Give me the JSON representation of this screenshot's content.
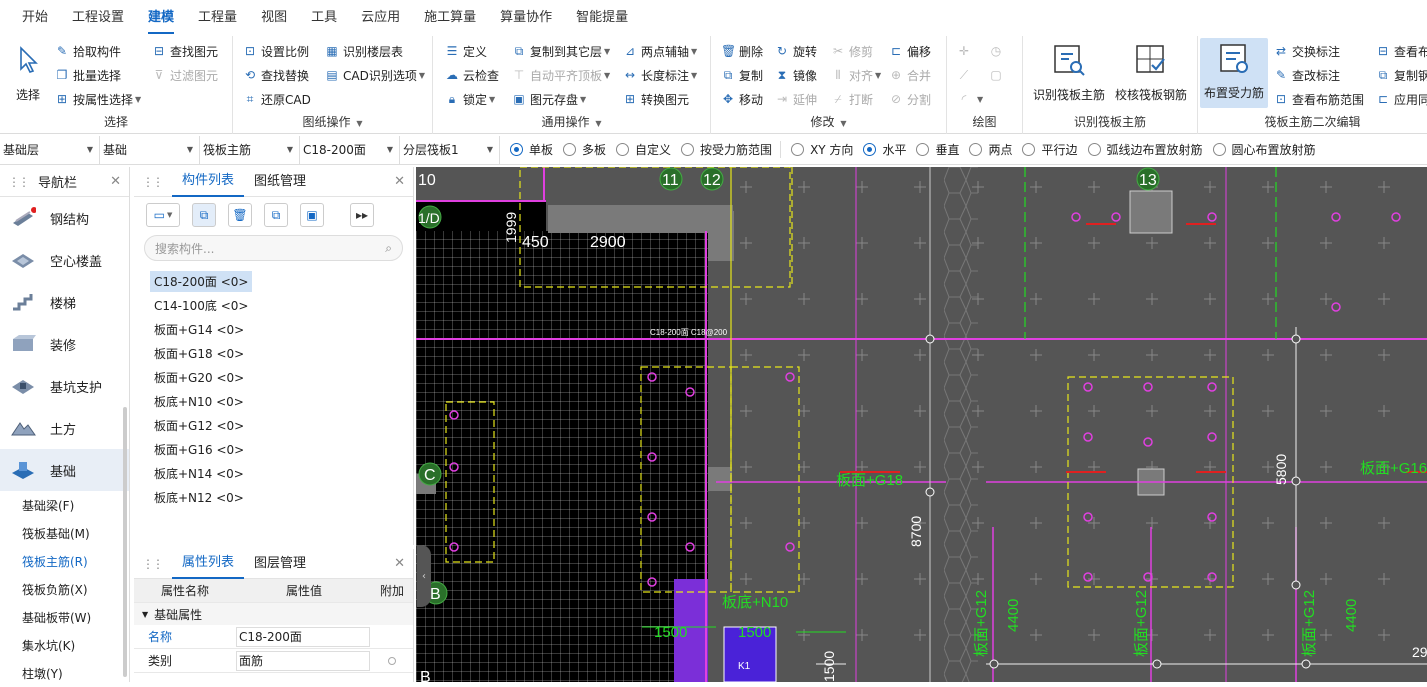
{
  "menu": [
    "开始",
    "工程设置",
    "建模",
    "工程量",
    "视图",
    "工具",
    "云应用",
    "施工算量",
    "算量协作",
    "智能提量"
  ],
  "active_menu": "建模",
  "ribbon": {
    "select_group": {
      "label": "选择",
      "big": "选择",
      "buttons": [
        "拾取构件",
        "批量选择",
        "按属性选择"
      ]
    },
    "drawing_group": {
      "label": "图纸操作",
      "buttons": [
        "查找图元",
        "过滤图元",
        "设置比例",
        "查找替换",
        "还原CAD",
        "识别楼层表",
        "CAD识别选项"
      ]
    },
    "general_group": {
      "label": "通用操作",
      "buttons": [
        "定义",
        "云检查",
        "锁定",
        "复制到其它层",
        "自动平齐顶板",
        "图元存盘",
        "两点辅轴",
        "长度标注",
        "转换图元"
      ]
    },
    "modify_group": {
      "label": "修改",
      "buttons": [
        "删除",
        "复制",
        "移动",
        "旋转",
        "镜像",
        "延伸",
        "修剪",
        "对齐",
        "打断",
        "偏移",
        "合并",
        "分割"
      ]
    },
    "draw_group": {
      "label": "绘图"
    },
    "recognize_group": {
      "label": "识别筏板主筋",
      "buttons": [
        "识别筏板主筋",
        "校核筏板钢筋"
      ]
    },
    "edit_group": {
      "label": "筏板主筋二次编辑",
      "big": "布置受力筋",
      "buttons": [
        "交换标注",
        "查改标注",
        "查看布筋范围",
        "查看布",
        "复制钢",
        "应用同"
      ]
    }
  },
  "propbar": {
    "combos": [
      "基础层",
      "基础",
      "筏板主筋",
      "C18-200面",
      "分层筏板1"
    ],
    "radios": [
      {
        "label": "单板",
        "on": true
      },
      {
        "label": "多板",
        "on": false
      },
      {
        "label": "自定义",
        "on": false
      },
      {
        "label": "按受力筋范围",
        "on": false
      },
      {
        "label": "XY 方向",
        "on": false
      },
      {
        "label": "水平",
        "on": true
      },
      {
        "label": "垂直",
        "on": false
      },
      {
        "label": "两点",
        "on": false
      },
      {
        "label": "平行边",
        "on": false
      },
      {
        "label": "弧线边布置放射筋",
        "on": false
      },
      {
        "label": "圆心布置放射筋",
        "on": false
      }
    ]
  },
  "nav": {
    "title": "导航栏",
    "items": [
      "钢结构",
      "空心楼盖",
      "楼梯",
      "装修",
      "基坑支护",
      "土方",
      "基础"
    ],
    "active": "基础",
    "subitems": [
      "基础梁(F)",
      "筏板基础(M)",
      "筏板主筋(R)",
      "筏板负筋(X)",
      "基础板带(W)",
      "集水坑(K)",
      "柱墩(Y)"
    ],
    "active_sub": "筏板主筋(R)"
  },
  "components": {
    "tabs": [
      "构件列表",
      "图纸管理"
    ],
    "search_placeholder": "搜索构件...",
    "items": [
      "C18-200面 <0>",
      "C14-100底 <0>",
      "板面+G14 <0>",
      "板面+G18 <0>",
      "板面+G20 <0>",
      "板底+N10 <0>",
      "板面+G12 <0>",
      "板面+G16 <0>",
      "板底+N14 <0>",
      "板底+N12 <0>"
    ]
  },
  "attributes": {
    "tabs": [
      "属性列表",
      "图层管理"
    ],
    "headers": [
      "属性名称",
      "属性值",
      "附加"
    ],
    "group": "基础属性",
    "rows": [
      {
        "name": "名称",
        "value": "C18-200面"
      },
      {
        "name": "类别",
        "value": "面筋"
      }
    ]
  },
  "canvas_labels": {
    "axis": [
      "10",
      "11",
      "12",
      "13",
      "1/D",
      "C",
      "B",
      "B"
    ],
    "dims": [
      "1999",
      "450",
      "2900",
      "8700",
      "5800",
      "1500",
      "1500",
      "4400",
      "4400",
      "1500",
      "29"
    ],
    "rebar": [
      "板面+G18",
      "板面+G16",
      "板底+N10",
      "板面+G12",
      "板面+G12",
      "板面+G12",
      "C18-200面 C18@200",
      "K1"
    ]
  },
  "colors": {
    "accent": "#1368c4",
    "canvas_bg": "#555555",
    "magenta": "#e040e0",
    "yellow": "#e6e61a",
    "green": "#22dd22"
  }
}
